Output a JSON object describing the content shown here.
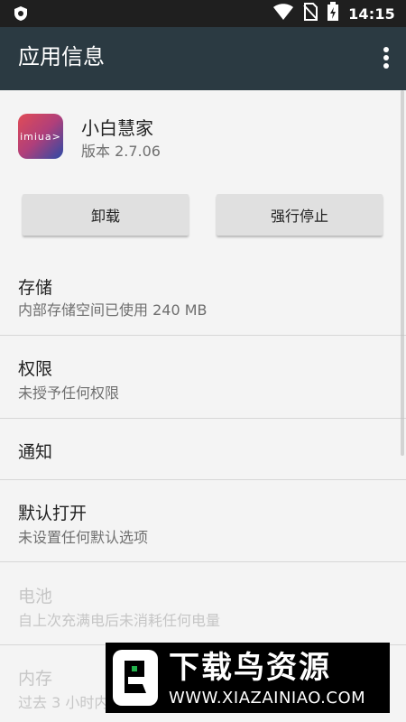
{
  "status_bar": {
    "time": "14:15",
    "icons": [
      "shield-icon",
      "wifi-icon",
      "no-sim-icon",
      "battery-charging-icon"
    ]
  },
  "app_bar": {
    "title": "应用信息",
    "menu_icon": "more-vert-icon"
  },
  "app": {
    "icon_text": "imiua>",
    "name": "小白慧家",
    "version": "版本 2.7.06"
  },
  "buttons": {
    "uninstall": "卸载",
    "force_stop": "强行停止"
  },
  "settings": [
    {
      "title": "存储",
      "subtitle": "内部存储空间已使用 240 MB",
      "enabled": true
    },
    {
      "title": "权限",
      "subtitle": "未授予任何权限",
      "enabled": true
    },
    {
      "title": "通知",
      "subtitle": "",
      "enabled": true
    },
    {
      "title": "默认打开",
      "subtitle": "未设置任何默认选项",
      "enabled": true
    },
    {
      "title": "电池",
      "subtitle": "自上次充满电后未消耗任何电量",
      "enabled": false
    },
    {
      "title": "内存",
      "subtitle": "过去 3 小时内",
      "enabled": false
    }
  ],
  "watermark": {
    "text": "下载鸟资源",
    "url": "WWW.XIAZAINIAO.COM"
  },
  "colors": {
    "status_bar": "#1f1f1f",
    "app_bar": "#2b3a42",
    "background": "#f4f4f4",
    "button": "#e0e0e0"
  }
}
